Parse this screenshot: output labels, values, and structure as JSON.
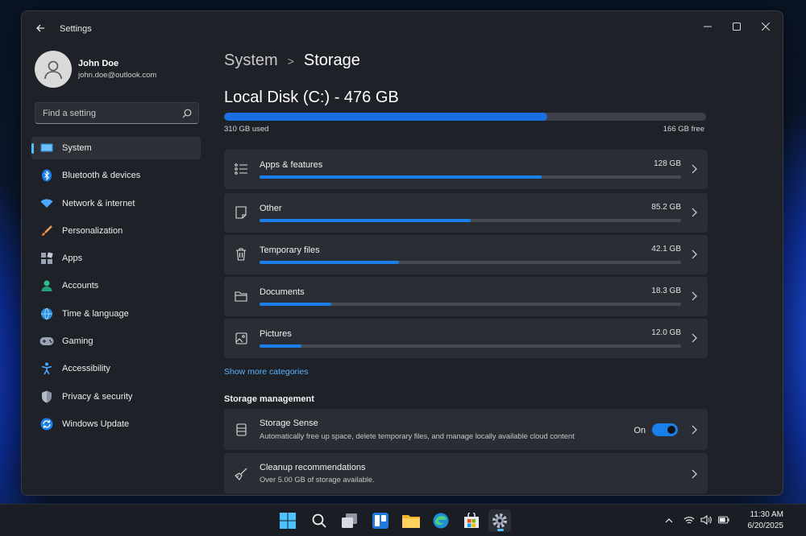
{
  "app": {
    "title": "Settings"
  },
  "user": {
    "name": "John Doe",
    "email": "john.doe@outlook.com"
  },
  "search": {
    "placeholder": "Find a setting"
  },
  "nav": {
    "items": [
      {
        "label": "System",
        "icon": "system-icon",
        "active": true
      },
      {
        "label": "Bluetooth & devices",
        "icon": "bluetooth-icon"
      },
      {
        "label": "Network & internet",
        "icon": "wifi-icon"
      },
      {
        "label": "Personalization",
        "icon": "brush-icon"
      },
      {
        "label": "Apps",
        "icon": "apps-icon"
      },
      {
        "label": "Accounts",
        "icon": "accounts-icon"
      },
      {
        "label": "Time & language",
        "icon": "globe-icon"
      },
      {
        "label": "Gaming",
        "icon": "gamepad-icon"
      },
      {
        "label": "Accessibility",
        "icon": "accessibility-icon"
      },
      {
        "label": "Privacy & security",
        "icon": "shield-icon"
      },
      {
        "label": "Windows Update",
        "icon": "update-icon"
      }
    ]
  },
  "breadcrumb": {
    "parent": "System",
    "separator": ">",
    "current": "Storage"
  },
  "disk": {
    "title": "Local Disk (C:) - 476 GB",
    "used_label": "310 GB used",
    "free_label": "166 GB free",
    "used_fraction": 0.67
  },
  "categories": [
    {
      "name": "Apps & features",
      "size": "128 GB",
      "fraction": 0.67,
      "icon": "apps-list-icon"
    },
    {
      "name": "Other",
      "size": "85.2 GB",
      "fraction": 0.5,
      "icon": "document-icon"
    },
    {
      "name": "Temporary files",
      "size": "42.1 GB",
      "fraction": 0.33,
      "icon": "trash-icon"
    },
    {
      "name": "Documents",
      "size": "18.3 GB",
      "fraction": 0.17,
      "icon": "folder-icon"
    },
    {
      "name": "Pictures",
      "size": "12.0 GB",
      "fraction": 0.1,
      "icon": "picture-icon"
    }
  ],
  "show_more": "Show more categories",
  "management": {
    "title": "Storage management",
    "storage_sense": {
      "name": "Storage Sense",
      "description": "Automatically free up space, delete temporary files, and manage locally available cloud content",
      "toggle_label": "On",
      "enabled": true
    },
    "cleanup": {
      "name": "Cleanup recommendations",
      "description": "Over 5.00 GB of storage available."
    }
  },
  "taskbar": {
    "time": "11:30 AM",
    "date": "6/20/2025"
  },
  "colors": {
    "accent": "#1a7fe8",
    "link": "#5bb3ff",
    "window_bg": "#1f2128",
    "card_bg": "#2b2d35"
  }
}
